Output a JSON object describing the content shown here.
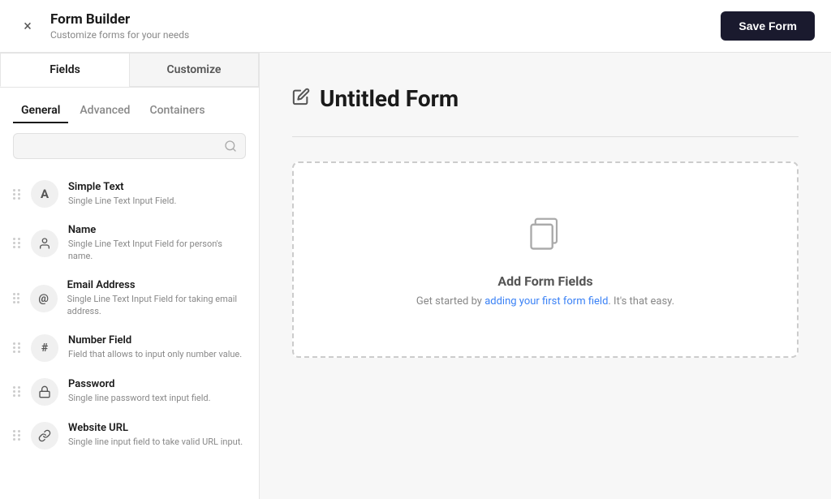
{
  "header": {
    "title": "Form Builder",
    "subtitle": "Customize forms for your needs",
    "save_label": "Save Form",
    "close_icon": "×"
  },
  "tabs_top": [
    {
      "id": "fields",
      "label": "Fields",
      "active": true
    },
    {
      "id": "customize",
      "label": "Customize",
      "active": false
    }
  ],
  "sub_tabs": [
    {
      "id": "general",
      "label": "General",
      "active": true
    },
    {
      "id": "advanced",
      "label": "Advanced",
      "active": false
    },
    {
      "id": "containers",
      "label": "Containers",
      "active": false
    }
  ],
  "search": {
    "placeholder": ""
  },
  "fields": [
    {
      "id": "simple-text",
      "name": "Simple Text",
      "desc": "Single Line Text Input Field.",
      "icon": "A"
    },
    {
      "id": "name",
      "name": "Name",
      "desc": "Single Line Text Input Field for person's name.",
      "icon": "👤"
    },
    {
      "id": "email",
      "name": "Email Address",
      "desc": "Single Line Text Input Field for taking email address.",
      "icon": "@"
    },
    {
      "id": "number",
      "name": "Number Field",
      "desc": "Field that allows to input only number value.",
      "icon": "#"
    },
    {
      "id": "password",
      "name": "Password",
      "desc": "Single line password text input field.",
      "icon": "🔒"
    },
    {
      "id": "website",
      "name": "Website URL",
      "desc": "Single line input field to take valid URL input.",
      "icon": "🔗"
    }
  ],
  "canvas": {
    "form_title": "Untitled Form",
    "drop_zone": {
      "title": "Add Form Fields",
      "desc_prefix": "Get started by ",
      "desc_link": "adding your first form field",
      "desc_suffix": ". It's that easy."
    }
  }
}
